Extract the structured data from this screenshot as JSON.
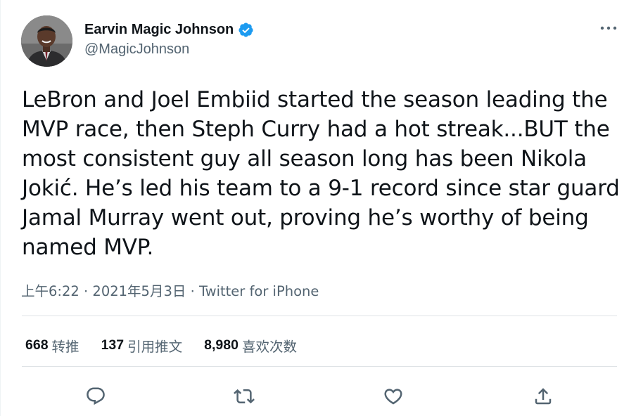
{
  "author": {
    "display_name": "Earvin Magic Johnson",
    "handle": "@MagicJohnson",
    "verified": true,
    "avatar_icon": "profile-photo"
  },
  "tweet": {
    "text": "LeBron and Joel Embiid started the season leading the MVP race, then Steph Curry had a hot streak...BUT the most consistent guy all season long has been Nikola Jokić. He’s led his team to a 9-1 record since star guard Jamal Murray went out, proving he’s worthy of being named MVP.",
    "time": "上午6:22",
    "separator": "·",
    "date": "2021年5月3日",
    "source": "Twitter for iPhone"
  },
  "stats": {
    "retweets": {
      "count": "668",
      "label": "转推"
    },
    "quotes": {
      "count": "137",
      "label": "引用推文"
    },
    "likes": {
      "count": "8,980",
      "label": "喜欢次数"
    }
  },
  "actions": {
    "reply_icon": "reply-icon",
    "retweet_icon": "retweet-icon",
    "like_icon": "heart-icon",
    "share_icon": "share-icon",
    "more_icon": "more-icon"
  },
  "colors": {
    "text_primary": "#0f1419",
    "text_secondary": "#536471",
    "verified_blue": "#1d9bf0",
    "divider": "#dfe3e6"
  }
}
